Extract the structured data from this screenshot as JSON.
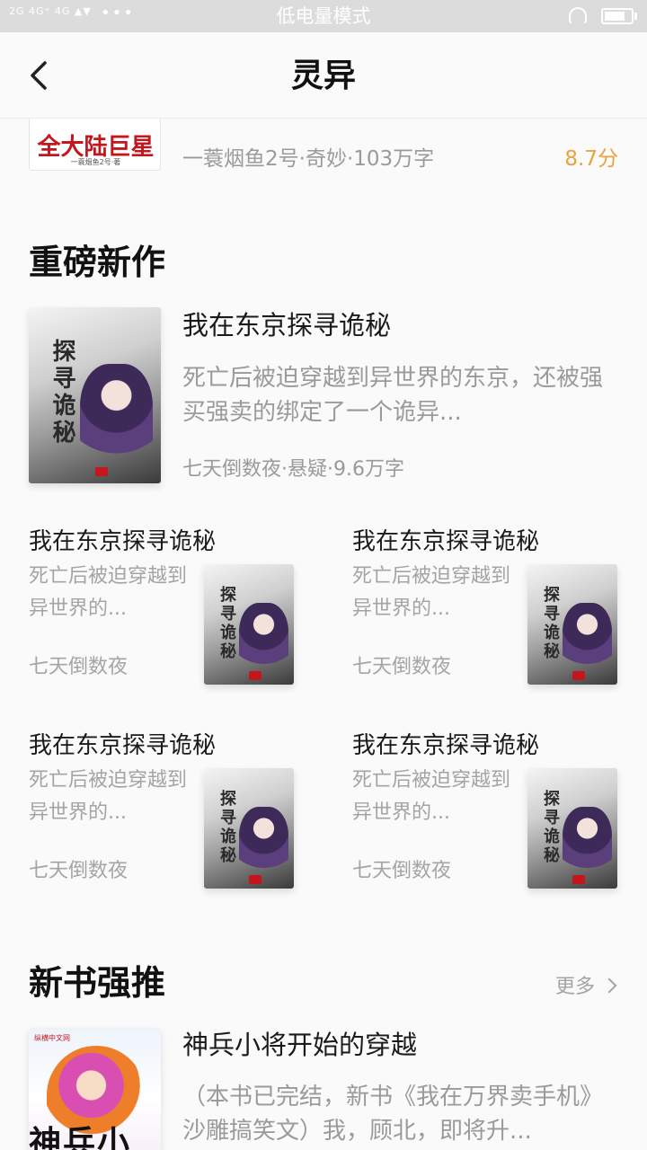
{
  "status_bar": {
    "left": "2G  4G⁺ 4G  ▲▼",
    "dots": "•••",
    "center": "低电量模式"
  },
  "nav": {
    "title": "灵异"
  },
  "prev_item": {
    "cover_title": "全大陆巨星",
    "cover_sub": "一蓑烟鱼2号·著",
    "meta": "一蓑烟鱼2号·奇妙·103万字",
    "score": "8.7分"
  },
  "section_new": {
    "title": "重磅新作",
    "featured": {
      "cover_text": "探寻诡秘",
      "title": "我在东京探寻诡秘",
      "desc": "死亡后被迫穿越到异世界的东京，还被强买强卖的绑定了一个诡异...",
      "meta": "七天倒数夜·悬疑·9.6万字"
    },
    "grid": [
      {
        "title": "我在东京探寻诡秘",
        "desc": "死亡后被迫穿越到异世界的...",
        "author": "七天倒数夜",
        "cover_text": "探寻诡秘"
      },
      {
        "title": "我在东京探寻诡秘",
        "desc": "死亡后被迫穿越到异世界的...",
        "author": "七天倒数夜",
        "cover_text": "探寻诡秘"
      },
      {
        "title": "我在东京探寻诡秘",
        "desc": "死亡后被迫穿越到异世界的...",
        "author": "七天倒数夜",
        "cover_text": "探寻诡秘"
      },
      {
        "title": "我在东京探寻诡秘",
        "desc": "死亡后被迫穿越到异世界的...",
        "author": "七天倒数夜",
        "cover_text": "探寻诡秘"
      }
    ]
  },
  "section_push": {
    "title": "新书强推",
    "more": "更多",
    "book": {
      "cover_logo": "纵横中文网",
      "cover_text": "神兵小将",
      "title": "神兵小将开始的穿越",
      "desc": "（本书已完结，新书《我在万界卖手机》沙雕搞笑文）我，顾北，即将升..."
    }
  },
  "colors": {
    "accent_score": "#e8a33a",
    "secondary_text": "#9a9a9a",
    "status_bar_bg": "#dcdcdc"
  }
}
